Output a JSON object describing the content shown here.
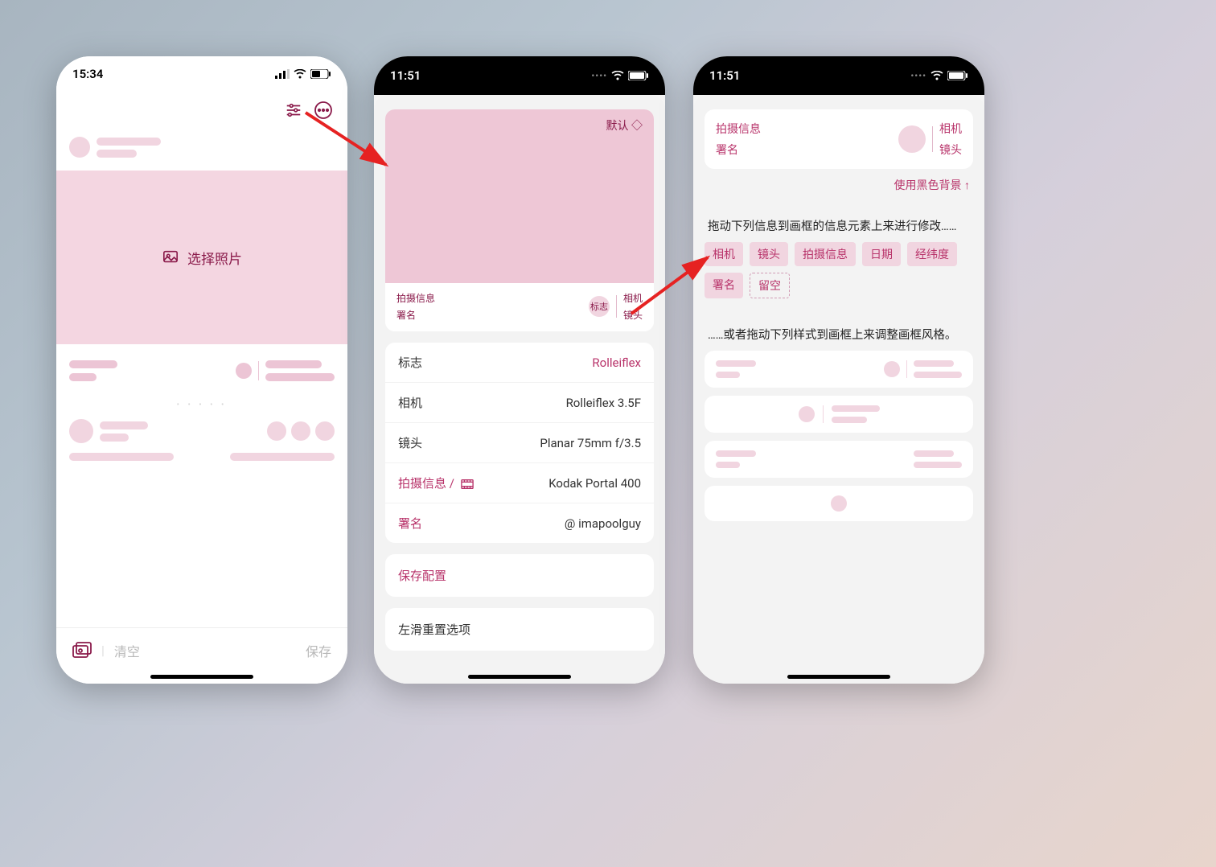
{
  "phone1": {
    "time": "15:34",
    "select_photo": "选择照片",
    "clear": "清空",
    "save": "保存"
  },
  "phone2": {
    "time": "11:51",
    "default": "默认 ◇",
    "preview": {
      "shooting_info": "拍摄信息",
      "signature": "署名",
      "logo": "标志",
      "camera": "相机",
      "lens": "镜头"
    },
    "rows": {
      "logo_label": "标志",
      "logo_value": "Rolleiflex",
      "camera_label": "相机",
      "camera_value": "Rolleiflex 3.5F",
      "lens_label": "镜头",
      "lens_value": "Planar 75mm f/3.5",
      "shoot_label": "拍摄信息  /",
      "shoot_value": "Kodak Portal 400",
      "sign_label": "署名",
      "sign_value": "@ imapoolguy"
    },
    "save_config": "保存配置",
    "swipe_reset": "左滑重置选项"
  },
  "phone3": {
    "time": "11:51",
    "header": {
      "shooting_info": "拍摄信息",
      "signature": "署名",
      "camera": "相机",
      "lens": "镜头"
    },
    "use_black_bg": "使用黑色背景 ↑",
    "instruction1": "拖动下列信息到画框的信息元素上来进行修改……",
    "tags": {
      "camera": "相机",
      "lens": "镜头",
      "shoot": "拍摄信息",
      "date": "日期",
      "latlng": "经纬度",
      "sign": "署名",
      "empty": "留空"
    },
    "instruction2": "……或者拖动下列样式到画框上来调整画框风格。"
  }
}
